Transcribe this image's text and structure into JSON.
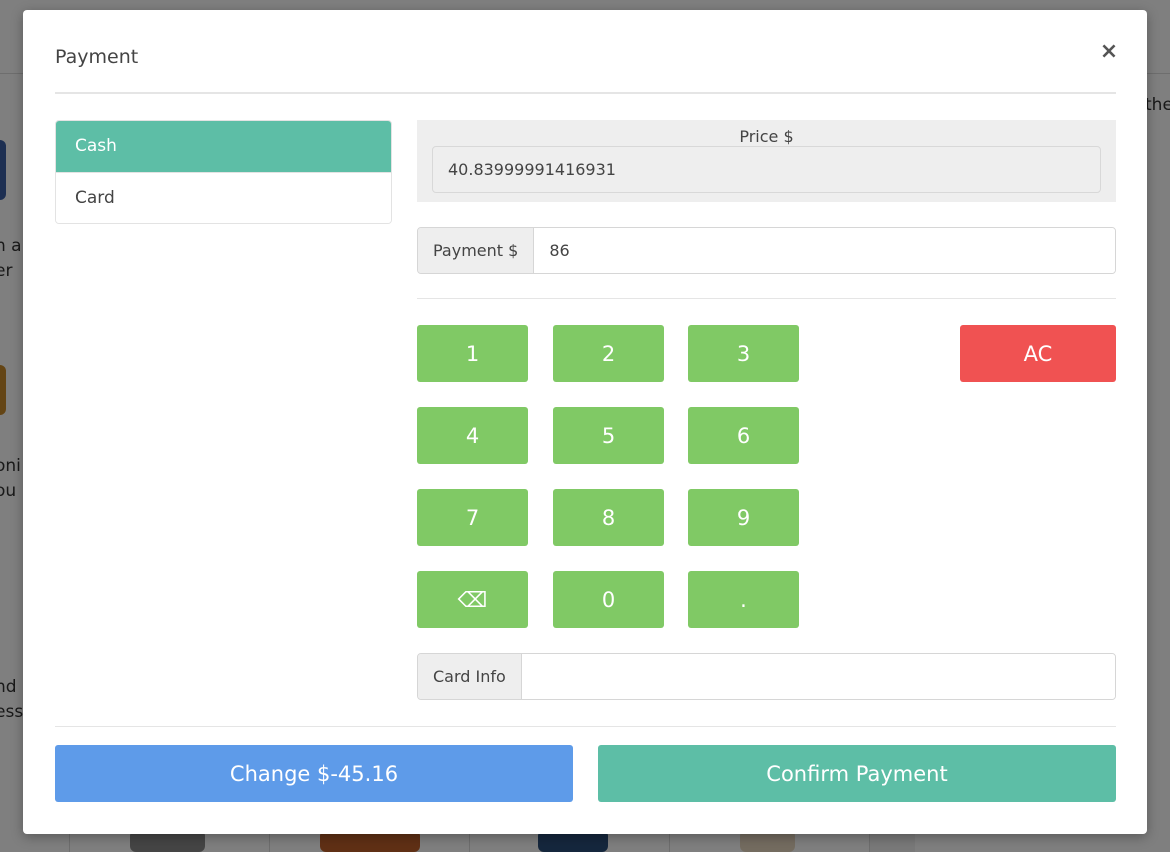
{
  "modal": {
    "title": "Payment",
    "close_label": "×"
  },
  "payment_methods": [
    {
      "label": "Cash",
      "active": true
    },
    {
      "label": "Card",
      "active": false
    }
  ],
  "price": {
    "label": "Price $",
    "value": "40.83999991416931"
  },
  "payment": {
    "label": "Payment $",
    "value": "86"
  },
  "keypad": {
    "keys": [
      "1",
      "2",
      "3",
      "4",
      "5",
      "6",
      "7",
      "8",
      "9",
      "⌫",
      "0",
      "."
    ],
    "clear_label": "AC"
  },
  "card_info": {
    "label": "Card Info",
    "value": ""
  },
  "footer": {
    "change_label": "Change $-45.16",
    "confirm_label": "Confirm Payment"
  },
  "colors": {
    "cash_active": "#5dbea6",
    "keypad": "#80c965",
    "clear": "#f05252",
    "change_button": "#5e9be9",
    "confirm_button": "#5dbea6"
  },
  "background_app": {
    "snippets": [
      "n a",
      "er",
      "oni",
      "ou",
      "nd",
      "ess",
      "the"
    ]
  }
}
